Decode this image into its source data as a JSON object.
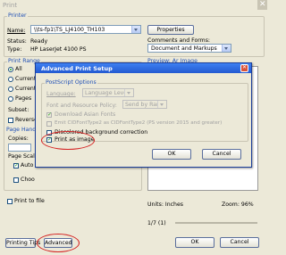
{
  "window": {
    "title": "Print"
  },
  "printer": {
    "group_label": "Printer",
    "name_label": "Name:",
    "name_value": "\\\\ts-fp1\\TS_LJ4100_TH103",
    "properties_label": "Properties",
    "status_label": "Status:",
    "status_value": "Ready",
    "type_label": "Type:",
    "type_value": "HP LaserJet 4100 PS",
    "comments_label": "Comments and Forms:",
    "comments_value": "Document and Markups"
  },
  "print_range": {
    "group_label": "Print Range",
    "options": [
      "All",
      "Current",
      "Current",
      "Pages"
    ],
    "subset_label": "Subset:",
    "reverse_label": "Reverse"
  },
  "page_handling": {
    "group_label": "Page Handl",
    "copies_label": "Copies:",
    "page_scaling_label": "Page Scali",
    "auto_label": "Auto",
    "choose_label": "Choo"
  },
  "preview": {
    "label": "Preview: Ar Image",
    "units": "Units: Inches",
    "zoom": "Zoom: 96%",
    "page_count": "1/7 (1)"
  },
  "print_to_file": "Print to file",
  "bottom": {
    "printing_tips": "Printing Tips",
    "advanced": "Advanced",
    "ok": "OK",
    "cancel": "Cancel"
  },
  "dialog": {
    "title": "Advanced Print Setup",
    "group_label": "PostScript Options",
    "language_label": "Language:",
    "language_value": "Language Level 3",
    "font_policy_label": "Font and Resource Policy:",
    "font_policy_value": "Send by Range",
    "download_asian": "Download Asian Fonts",
    "emit_cid": "Emit CIDFontType2 as CIDFontType2 (PS version 2015 and greater)",
    "discolored": "Discolored background correction",
    "print_as_image": "Print as image",
    "ok": "OK",
    "cancel": "Cancel",
    "close_symbol": "✕"
  },
  "colors": {
    "highlight_ring": "#d42020",
    "title_bar": "#2a63d8"
  }
}
